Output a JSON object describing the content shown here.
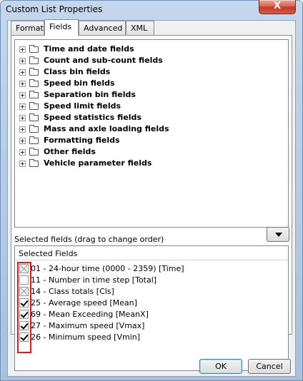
{
  "window": {
    "title": "Custom List Properties",
    "close_label": "X"
  },
  "tabs": [
    {
      "label": "Format"
    },
    {
      "label": "Fields"
    },
    {
      "label": "Advanced"
    },
    {
      "label": "XML"
    }
  ],
  "tree": {
    "items": [
      {
        "label": "Time and date fields"
      },
      {
        "label": "Count and sub-count fields"
      },
      {
        "label": "Class bin fields"
      },
      {
        "label": "Speed bin fields"
      },
      {
        "label": "Separation bin fields"
      },
      {
        "label": "Speed limit fields"
      },
      {
        "label": "Speed statistics fields"
      },
      {
        "label": "Mass and axle loading fields"
      },
      {
        "label": "Formatting fields"
      },
      {
        "label": "Other fields"
      },
      {
        "label": "Vehicle parameter fields"
      }
    ]
  },
  "selected": {
    "caption": "Selected fields (drag to change order)",
    "header": "Selected Fields",
    "rows": [
      {
        "text": "01 - 24-hour time (0000 - 2359) [Time]",
        "state": "indeterminate"
      },
      {
        "text": "11 - Number in time step [Total]",
        "state": "unchecked"
      },
      {
        "text": "14 - Class totals [Cls]",
        "state": "indeterminate"
      },
      {
        "text": "25 - Average speed [Mean]",
        "state": "checked"
      },
      {
        "text": "69 - Mean Exceeding [MeanX]",
        "state": "checked"
      },
      {
        "text": "27 - Maximum speed [Vmax]",
        "state": "checked"
      },
      {
        "text": "26 - Minimum speed [Vmin]",
        "state": "checked"
      }
    ],
    "highlight_color": "#e01818"
  },
  "buttons": {
    "ok": "OK",
    "cancel": "Cancel"
  }
}
